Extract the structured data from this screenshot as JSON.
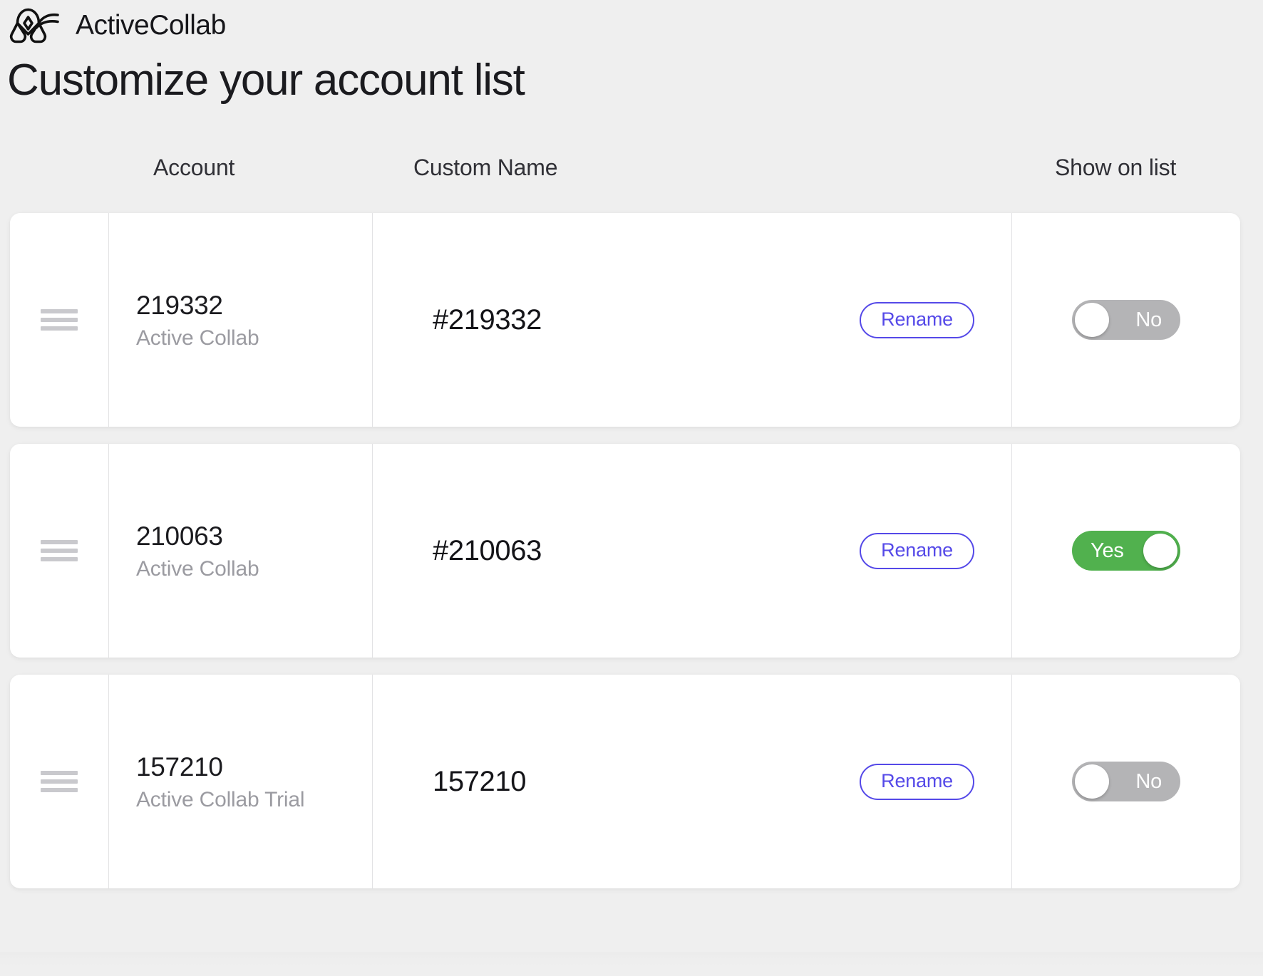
{
  "brand": {
    "name": "ActiveCollab",
    "logo_icon": "activecollab-logo-icon"
  },
  "page": {
    "title": "Customize your account list"
  },
  "table": {
    "headers": {
      "account": "Account",
      "custom_name": "Custom Name",
      "show_on_list": "Show on list"
    },
    "rows": [
      {
        "drag_icon": "drag-handle-icon",
        "account_id": "219332",
        "account_type": "Active Collab",
        "custom_name": "#219332",
        "rename_label": "Rename",
        "show_on_list": "No",
        "show_on_list_state": "off"
      },
      {
        "drag_icon": "drag-handle-icon",
        "account_id": "210063",
        "account_type": "Active Collab",
        "custom_name": "#210063",
        "rename_label": "Rename",
        "show_on_list": "Yes",
        "show_on_list_state": "on"
      },
      {
        "drag_icon": "drag-handle-icon",
        "account_id": "157210",
        "account_type": "Active Collab Trial",
        "custom_name": "157210",
        "rename_label": "Rename",
        "show_on_list": "No",
        "show_on_list_state": "off"
      }
    ]
  },
  "colors": {
    "accent": "#5549e8",
    "toggle_on": "#51b14e",
    "toggle_off": "#b4b4b6",
    "page_background": "#efefef",
    "card_background": "#ffffff",
    "muted_text": "#9b9ba1"
  }
}
